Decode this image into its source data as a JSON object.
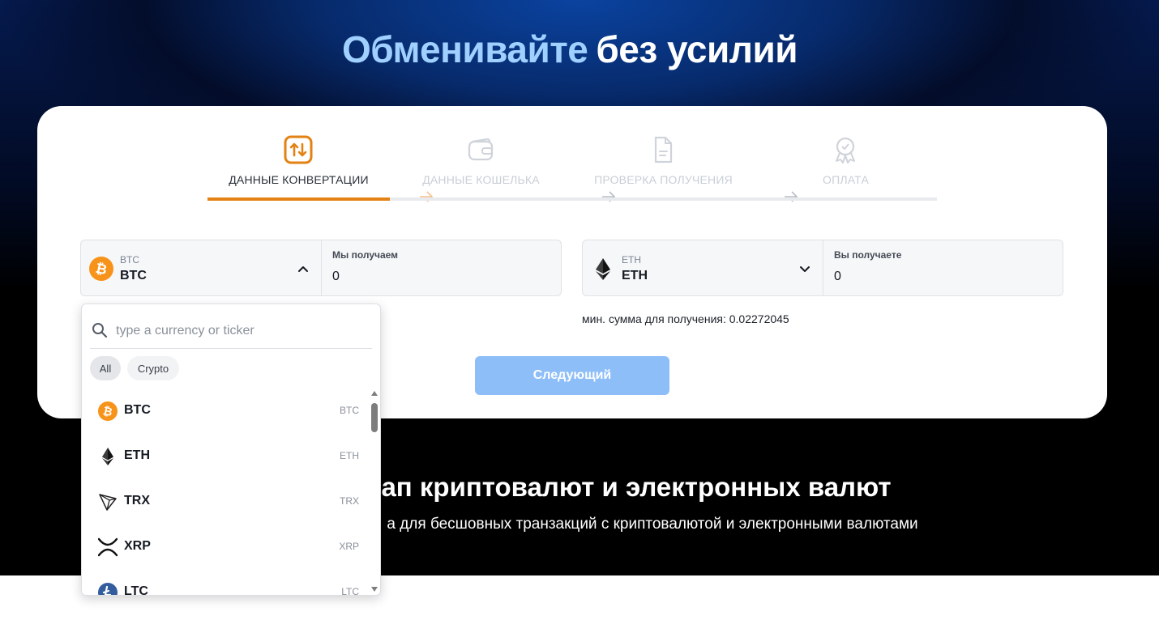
{
  "hero": {
    "title_accent": "Обменивайте",
    "title_rest": "без усилий",
    "heading_partial": "ап криптовалют и электронных валют",
    "description_partial": "а для бесшовных транзакций с криптовалютой и электронными валютами"
  },
  "steps": [
    {
      "label": "ДАННЫЕ КОНВЕРТАЦИИ",
      "icon": "exchange-icon",
      "active": true
    },
    {
      "label": "ДАННЫЕ КОШЕЛЬКА",
      "icon": "wallet-icon",
      "active": false
    },
    {
      "label": "ПРОВЕРКА ПОЛУЧЕНИЯ",
      "icon": "document-icon",
      "active": false
    },
    {
      "label": "ОПЛАТА",
      "icon": "award-icon",
      "active": false
    }
  ],
  "send": {
    "ticker_small": "BTC",
    "ticker": "BTC",
    "amount_label": "Мы получаем",
    "amount": "0"
  },
  "receive": {
    "ticker_small": "ETH",
    "ticker": "ETH",
    "amount_label": "Вы получаете",
    "amount": "0"
  },
  "min_amount": "мин. сумма для получения: 0.02272045",
  "next_label": "Следующий",
  "dropdown": {
    "search_placeholder": "type a currency or ticker",
    "filters": [
      "All",
      "Crypto"
    ],
    "items": [
      {
        "name": "BTC",
        "ticker": "BTC",
        "icon": "bitcoin-icon"
      },
      {
        "name": "ETH",
        "ticker": "ETH",
        "icon": "ethereum-icon"
      },
      {
        "name": "TRX",
        "ticker": "TRX",
        "icon": "tron-icon"
      },
      {
        "name": "XRP",
        "ticker": "XRP",
        "icon": "xrp-icon"
      },
      {
        "name": "LTC",
        "ticker": "LTC",
        "icon": "litecoin-icon"
      }
    ]
  },
  "colors": {
    "accent": "#e38212",
    "title_accent": "#9fd0ff",
    "button": "#8ebef8",
    "bitcoin": "#f7931a",
    "litecoin": "#345d9d"
  }
}
